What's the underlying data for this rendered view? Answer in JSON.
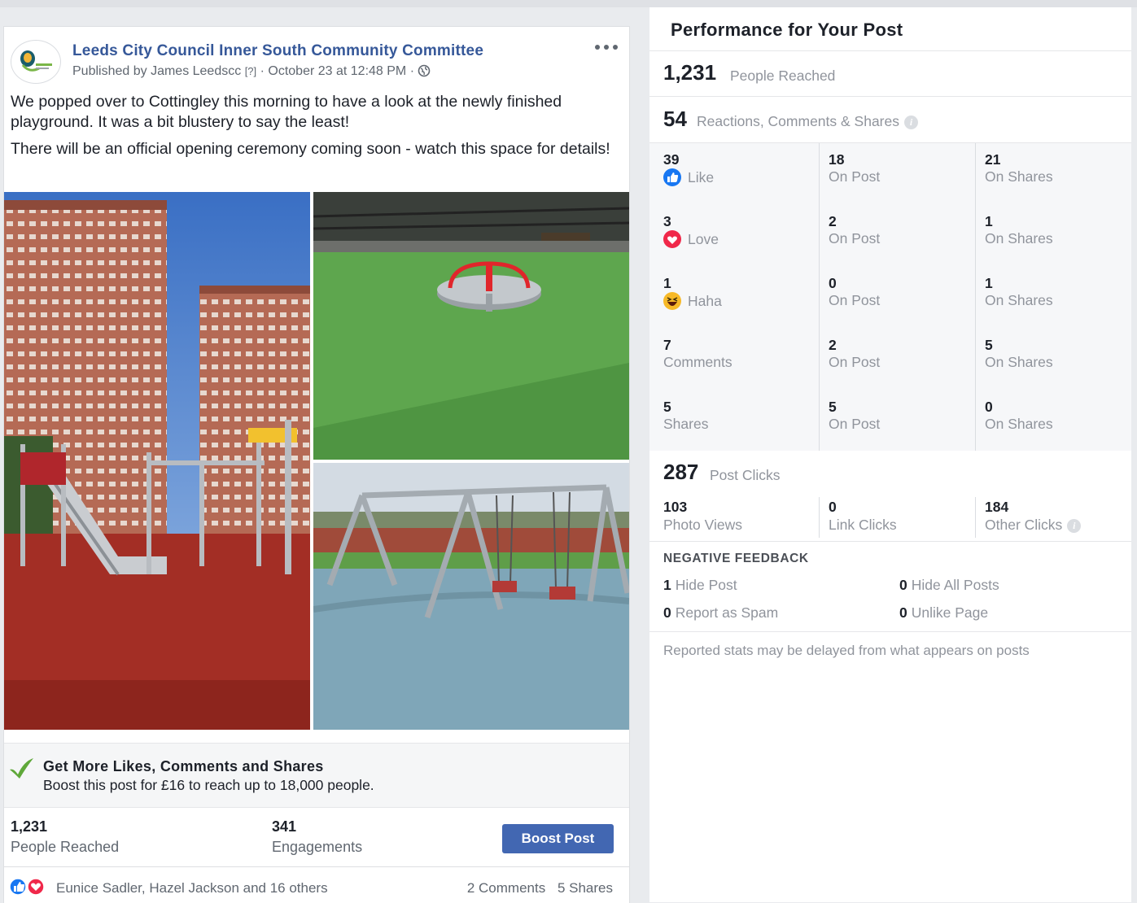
{
  "post": {
    "page_name": "Leeds City Council Inner South Community Committee",
    "published_by": "Published by James Leedscc",
    "help_mark": "[?]",
    "timestamp": "· October 23 at 12:48 PM ·",
    "text_1": "We popped over to Cottingley this morning to have a look at the newly finished playground. It was a bit blustery to say the least!",
    "text_2": "There will be an official opening ceremony coming soon - watch this space for details!",
    "icons": {
      "avatar": "community-committee-logo",
      "privacy": "globe-icon",
      "menu": "more-options-icon"
    }
  },
  "promo": {
    "title": "Get More Likes, Comments and Shares",
    "subtitle": "Boost this post for £16 to reach up to 18,000 people.",
    "icon": "green-leaf-check-icon"
  },
  "post_stats": {
    "reached_value": "1,231",
    "reached_label": "People Reached",
    "engagements_value": "341",
    "engagements_label": "Engagements",
    "boost_label": "Boost Post"
  },
  "footer": {
    "reactors": "Eunice Sadler, Hazel Jackson and 16 others",
    "comments": "2 Comments",
    "shares": "5 Shares"
  },
  "performance": {
    "title": "Performance for Your Post",
    "reached_value": "1,231",
    "reached_label": "People Reached",
    "rcs_value": "54",
    "rcs_label": "Reactions, Comments & Shares",
    "rows": [
      {
        "value": "39",
        "label": "Like",
        "icon": "like-icon",
        "post_value": "18",
        "post_label": "On Post",
        "shares_value": "21",
        "shares_label": "On Shares"
      },
      {
        "value": "3",
        "label": "Love",
        "icon": "love-icon",
        "post_value": "2",
        "post_label": "On Post",
        "shares_value": "1",
        "shares_label": "On Shares"
      },
      {
        "value": "1",
        "label": "Haha",
        "icon": "haha-icon",
        "post_value": "0",
        "post_label": "On Post",
        "shares_value": "1",
        "shares_label": "On Shares"
      },
      {
        "value": "7",
        "label": "Comments",
        "post_value": "2",
        "post_label": "On Post",
        "shares_value": "5",
        "shares_label": "On Shares"
      },
      {
        "value": "5",
        "label": "Shares",
        "post_value": "5",
        "post_label": "On Post",
        "shares_value": "0",
        "shares_label": "On Shares"
      }
    ],
    "post_clicks_value": "287",
    "post_clicks_label": "Post Clicks",
    "clicks": [
      {
        "value": "103",
        "label": "Photo Views"
      },
      {
        "value": "0",
        "label": "Link Clicks"
      },
      {
        "value": "184",
        "label": "Other Clicks"
      }
    ],
    "negative_title": "NEGATIVE FEEDBACK",
    "negative": [
      {
        "value": "1",
        "label": "Hide Post"
      },
      {
        "value": "0",
        "label": "Hide All Posts"
      },
      {
        "value": "0",
        "label": "Report as Spam"
      },
      {
        "value": "0",
        "label": "Unlike Page"
      }
    ],
    "disclaimer": "Reported stats may be delayed from what appears on posts"
  },
  "colors": {
    "link_blue": "#365899",
    "button_blue": "#4267b2",
    "grey_text": "#90949c",
    "like_blue": "#1877f2",
    "love_red": "#f0284a",
    "haha_yellow": "#f7b928"
  }
}
